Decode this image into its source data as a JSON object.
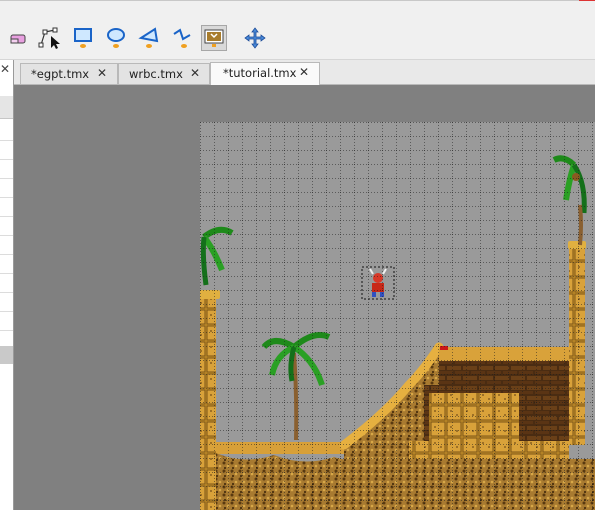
{
  "toolbar": {
    "tools": [
      {
        "name": "eraser-tool",
        "icon": "eraser-icon"
      },
      {
        "name": "select-objects-tool",
        "icon": "select-objects-icon"
      },
      {
        "name": "insert-rectangle-tool",
        "icon": "rectangle-icon"
      },
      {
        "name": "insert-ellipse-tool",
        "icon": "ellipse-icon"
      },
      {
        "name": "insert-polygon-tool",
        "icon": "polygon-icon"
      },
      {
        "name": "insert-polyline-tool",
        "icon": "polyline-icon"
      },
      {
        "name": "insert-tile-tool",
        "icon": "insert-tile-icon",
        "active": true
      },
      {
        "name": "move-tool",
        "icon": "move-icon"
      }
    ]
  },
  "tabs": [
    {
      "label": "*egpt.tmx",
      "close": "✕",
      "active": false
    },
    {
      "label": "wrbc.tmx",
      "close": "✕",
      "active": false
    },
    {
      "label": "*tutorial.tmx",
      "close": "✕",
      "active": true
    }
  ],
  "left_panel": {
    "close": "✕"
  },
  "colors": {
    "canvas_background": "#808080",
    "map_background": "#9a9a9a",
    "grid": "#1c1c1c",
    "sand": "#c8922a",
    "brick_dark": "#3a2410",
    "palm_leaf": "#1e8a1a",
    "active_tool_bg": "#d9d9d9"
  }
}
